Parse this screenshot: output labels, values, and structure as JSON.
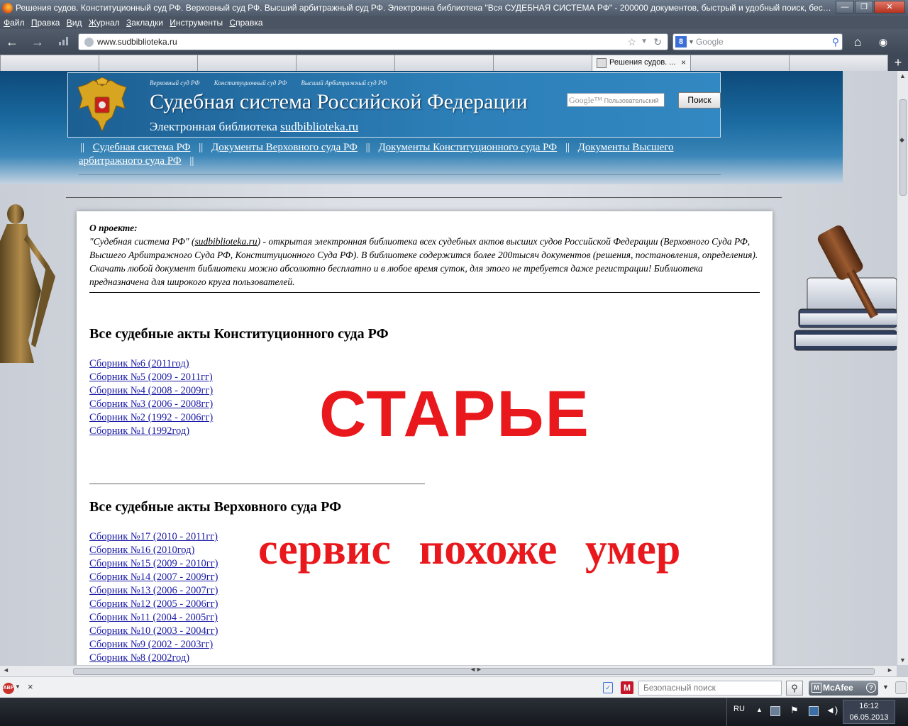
{
  "window": {
    "title": "Решения судов. Конституционный суд РФ. Верховный суд РФ. Высший арбитражный суд РФ. Электронна библиотека \"Вся СУДЕБНАЯ СИСТЕМА РФ\" - 200000 документов, быстрый и удобный поиск, бесплат...",
    "controls": {
      "minimize": "—",
      "maximize": "❐",
      "close": "✕"
    }
  },
  "menu": [
    "Файл",
    "Правка",
    "Вид",
    "Журнал",
    "Закладки",
    "Инструменты",
    "Справка"
  ],
  "navigation": {
    "back": "←",
    "forward": "→",
    "url": "www.sudbiblioteka.ru",
    "search_engine": "8",
    "search_placeholder": "Google",
    "home": "⌂"
  },
  "tabs": {
    "active_label": "Решения судов. ...",
    "close": "×",
    "new_tab": "+"
  },
  "site": {
    "top_links": [
      "Верховный суд РФ",
      "Конституционный суд РФ",
      "Высший Арбитражный суд РФ"
    ],
    "title": "Судебная система Российской Федерации",
    "subtitle_prefix": "Электронная библиотека",
    "subtitle_link": "sudbiblioteka.ru",
    "search_brand": "Google™",
    "search_placeholder": "Пользовательский",
    "search_button": "Поиск",
    "nav": {
      "sep": "||",
      "links": [
        "Судебная система РФ",
        "Документы Верховного суда РФ",
        "Документы Конституционного суда РФ",
        "Документы Высшего арбитражного суда РФ"
      ]
    }
  },
  "about": {
    "heading": "О проекте:",
    "lead_open": "\"Судебная система РФ\" (",
    "lead_link": "sudbiblioteka.ru",
    "text": ") - открытая электронная библиотека всех судебных актов высших судов Российской Федерации (Верховного Суда РФ, Высшего Арбитражного Суда РФ, Конституционного Суда РФ). В библиотеке содержится более 200тысяч документов (решения, постановления, определения). Скачать любой документ библиотеки можно абсолютно бесплатно и в любое время суток, для этого не требуется даже регистрации! Библиотека предназначена для широкого круга пользователей."
  },
  "sections": {
    "constitutional": {
      "heading": "Все судебные акты Конституционного суда РФ",
      "links": [
        "Сборник №6 (2011год)",
        "Сборник №5 (2009 - 2011гг)",
        "Сборник №4 (2008 - 2009гг)",
        "Сборник №3 (2006 - 2008гг)",
        "Сборник №2 (1992 - 2006гг)",
        "Сборник №1 (1992год)"
      ]
    },
    "supreme": {
      "heading": "Все судебные акты Верховного суда РФ",
      "links": [
        "Сборник №17 (2010 - 2011гг)",
        "Сборник №16 (2010год)",
        "Сборник №15 (2009 - 2010гг)",
        "Сборник №14 (2007 - 2009гг)",
        "Сборник №13 (2006 - 2007гг)",
        "Сборник №12 (2005 - 2006гг)",
        "Сборник №11 (2004 - 2005гг)",
        "Сборник №10 (2003 - 2004гг)",
        "Сборник №9 (2002 - 2003гг)",
        "Сборник №8 (2002год)"
      ]
    }
  },
  "overlay": {
    "line1": "СТАРЬЕ",
    "line2": "сервис похоже умер",
    "color": "#e8181c"
  },
  "addon_bar": {
    "abp": "ABP",
    "close": "×",
    "mcafee_m": "M",
    "safe_search_placeholder": "Безопасный поиск",
    "mcafee": "McAfee",
    "mcafee_help": "?"
  },
  "taskbar": {
    "lang": "RU",
    "time": "16:12",
    "date": "06.05.2013"
  },
  "colors": {
    "header_blue": "#1a6aa0",
    "link_blue": "#1a1aa6"
  }
}
